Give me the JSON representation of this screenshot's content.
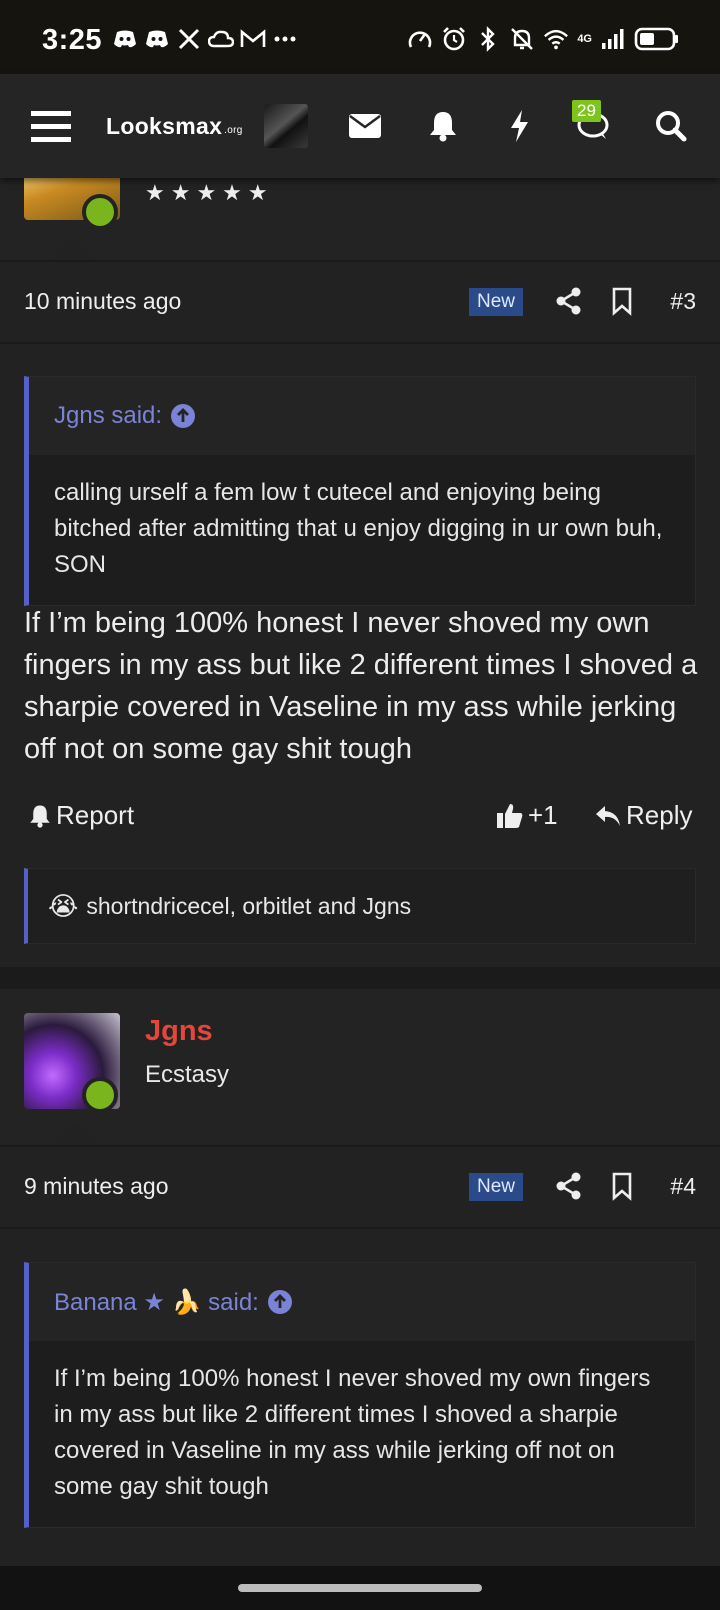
{
  "status_bar": {
    "time": "3:25",
    "left_icons": [
      "discord-icon",
      "discord-icon",
      "x-icon",
      "cloud-icon",
      "gmail-icon",
      "more-icon"
    ],
    "right_icons": [
      "speedometer-icon",
      "alarm-icon",
      "bluetooth-icon",
      "mute-icon",
      "wifi-icon",
      "signal-icon",
      "battery-icon"
    ],
    "network_label": "4G",
    "battery_level": 0.45
  },
  "navbar": {
    "logo_text": "Looksmax",
    "logo_suffix": ".org",
    "conversations_badge": "29"
  },
  "posts": [
    {
      "rating_stars": "★★★★★",
      "time": "10 minutes ago",
      "new_label": "New",
      "post_number": "#3",
      "quote": {
        "author_said": "Jgns said:",
        "text": "calling urself a fem low t cutecel and enjoying being bitched after admitting that u enjoy digging in ur own buh, SON"
      },
      "text": "If I’m being 100% honest I never shoved my own fingers in my ass but like 2 different times I shoved a sharpie covered in Vaseline in my ass while jerking off not on some gay shit tough",
      "actions": {
        "report": "Report",
        "like_count": "+1",
        "reply": "Reply"
      },
      "reactions": {
        "emoji": "😭",
        "users": "shortndricecel, orbitlet and Jgns"
      }
    },
    {
      "username": "Jgns",
      "user_title": "Ecstasy",
      "time": "9 minutes ago",
      "new_label": "New",
      "post_number": "#4",
      "quote": {
        "author_said": "Banana ★ 🍌 said:",
        "text": "If I’m being 100% honest I never shoved my own fingers in my ass but like 2 different times I shoved a sharpie covered in Vaseline in my ass while jerking off not on some gay shit tough"
      }
    }
  ],
  "colors": {
    "accent_quote": "#5660c8",
    "username_red": "#e4463a",
    "online_green": "#7ab51d",
    "new_badge_bg": "#2a4a8a",
    "badge_green": "#7fc41d"
  }
}
